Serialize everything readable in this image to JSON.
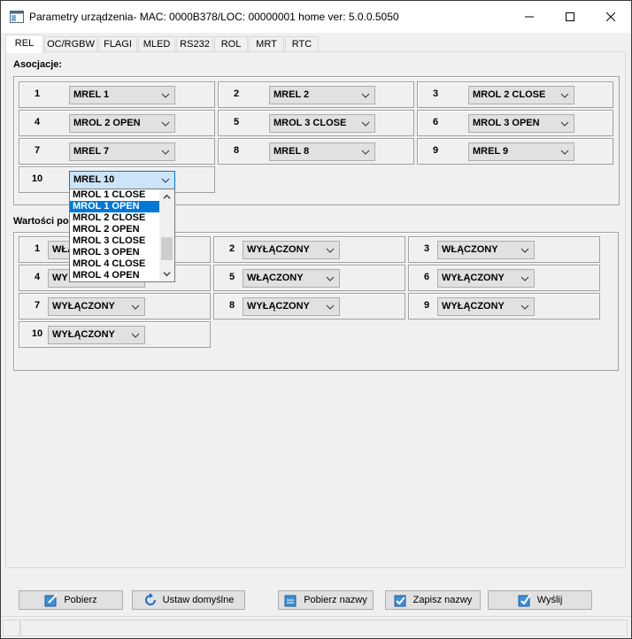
{
  "window": {
    "title": "Parametry urządzenia- MAC: 0000B378/LOC: 00000001 home ver: 5.0.0.5050"
  },
  "tabs": [
    {
      "label": "REL",
      "active": true
    },
    {
      "label": "OC/RGBW"
    },
    {
      "label": "FLAGI"
    },
    {
      "label": "MLED"
    },
    {
      "label": "RS232"
    },
    {
      "label": "ROL"
    },
    {
      "label": "MRT"
    },
    {
      "label": "RTC"
    }
  ],
  "associations": {
    "label": "Asocjacje:",
    "items": [
      {
        "num": "1",
        "value": "MREL 1"
      },
      {
        "num": "2",
        "value": "MREL 2"
      },
      {
        "num": "3",
        "value": "MROL 2 CLOSE"
      },
      {
        "num": "4",
        "value": "MROL 2 OPEN"
      },
      {
        "num": "5",
        "value": "MROL 3 CLOSE"
      },
      {
        "num": "6",
        "value": "MROL 3 OPEN"
      },
      {
        "num": "7",
        "value": "MREL 7"
      },
      {
        "num": "8",
        "value": "MREL 8"
      },
      {
        "num": "9",
        "value": "MREL 9"
      },
      {
        "num": "10",
        "value": "MREL 10"
      }
    ]
  },
  "dropdown": {
    "options": [
      "MROL 1 CLOSE",
      "MROL 1 OPEN",
      "MROL 2 CLOSE",
      "MROL 2 OPEN",
      "MROL 3 CLOSE",
      "MROL 3 OPEN",
      "MROL 4 CLOSE",
      "MROL 4 OPEN"
    ],
    "highlighted": "MROL 1 OPEN"
  },
  "values": {
    "label": "Wartości po",
    "items": [
      {
        "num": "1",
        "value": "WŁĄ"
      },
      {
        "num": "2",
        "value": "WYŁĄCZONY"
      },
      {
        "num": "3",
        "value": "WŁĄCZONY"
      },
      {
        "num": "4",
        "value": "WY"
      },
      {
        "num": "5",
        "value": "WŁĄCZONY"
      },
      {
        "num": "6",
        "value": "WYŁĄCZONY"
      },
      {
        "num": "7",
        "value": "WYŁĄCZONY"
      },
      {
        "num": "8",
        "value": "WYŁĄCZONY"
      },
      {
        "num": "9",
        "value": "WYŁĄCZONY"
      },
      {
        "num": "10",
        "value": "WYŁĄCZONY"
      }
    ]
  },
  "buttons": {
    "pobierz": "Pobierz",
    "ustaw": "Ustaw domyślne",
    "pobierz_nazwy": "Pobierz nazwy",
    "zapisz_nazwy": "Zapisz nazwy",
    "wyslij": "Wyślij"
  },
  "icons": {
    "pobierz": "edit-icon",
    "ustaw": "refresh-icon",
    "pobierz_nazwy": "download-names-icon",
    "zapisz_nazwy": "save-names-icon",
    "wyslij": "send-icon"
  },
  "colors": {
    "accent": "#0078d7",
    "selection": "#cce4f7"
  }
}
